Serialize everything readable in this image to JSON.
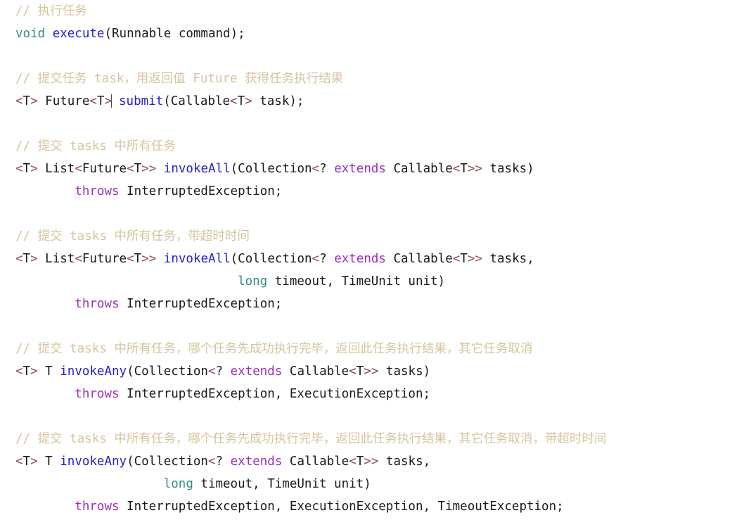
{
  "editor": {
    "background_color": "#ffffff",
    "font_size_px": 17.5,
    "line_height_px": 32,
    "caret_visible": true,
    "caret_line_index": 3,
    "colors": {
      "comment": "#d6c49c",
      "keyword": "#2f8f7f",
      "method": "#2222cc",
      "generic_bracket": "#8d4f4f",
      "throws_extends": "#9b2fbe",
      "plain_text": "#1a1a1a",
      "caret": "#4a4a55"
    }
  },
  "code": {
    "language": "java",
    "lines": [
      {
        "id": "line-1",
        "kind": "comment",
        "text": "// 执行任务",
        "tokens": [
          {
            "t": "// 执行任务",
            "c": "comment"
          }
        ]
      },
      {
        "id": "line-2",
        "kind": "signature",
        "text": "void execute(Runnable command);",
        "tokens": [
          {
            "t": "void",
            "c": "keyword"
          },
          {
            "t": " ",
            "c": "plain"
          },
          {
            "t": "execute",
            "c": "method"
          },
          {
            "t": "(Runnable command);",
            "c": "plain"
          }
        ]
      },
      {
        "id": "line-3",
        "kind": "blank",
        "text": "",
        "tokens": []
      },
      {
        "id": "line-4",
        "kind": "comment",
        "text": "// 提交任务 task，用返回值 Future 获得任务执行结果",
        "tokens": [
          {
            "t": "// 提交任务 task，用返回值 Future 获得任务执行结果",
            "c": "comment"
          }
        ]
      },
      {
        "id": "line-5",
        "kind": "signature",
        "text": "<T> Future<T> submit(Callable<T> task);",
        "tokens": [
          {
            "t": "<",
            "c": "generic"
          },
          {
            "t": "T",
            "c": "plain"
          },
          {
            "t": ">",
            "c": "generic"
          },
          {
            "t": " Future",
            "c": "plain"
          },
          {
            "t": "<",
            "c": "generic"
          },
          {
            "t": "T",
            "c": "plain"
          },
          {
            "t": ">",
            "c": "generic"
          },
          {
            "t": "CARET",
            "c": "caret"
          },
          {
            "t": " ",
            "c": "plain"
          },
          {
            "t": "submit",
            "c": "method"
          },
          {
            "t": "(Callable",
            "c": "plain"
          },
          {
            "t": "<",
            "c": "generic"
          },
          {
            "t": "T",
            "c": "plain"
          },
          {
            "t": ">",
            "c": "generic"
          },
          {
            "t": " task);",
            "c": "plain"
          }
        ]
      },
      {
        "id": "line-6",
        "kind": "blank",
        "text": "",
        "tokens": []
      },
      {
        "id": "line-7",
        "kind": "comment",
        "text": "// 提交 tasks 中所有任务",
        "tokens": [
          {
            "t": "// 提交 tasks 中所有任务",
            "c": "comment"
          }
        ]
      },
      {
        "id": "line-8",
        "kind": "signature",
        "text": "<T> List<Future<T>> invokeAll(Collection<? extends Callable<T>> tasks)",
        "tokens": [
          {
            "t": "<",
            "c": "generic"
          },
          {
            "t": "T",
            "c": "plain"
          },
          {
            "t": ">",
            "c": "generic"
          },
          {
            "t": " List",
            "c": "plain"
          },
          {
            "t": "<",
            "c": "generic"
          },
          {
            "t": "Future",
            "c": "plain"
          },
          {
            "t": "<",
            "c": "generic"
          },
          {
            "t": "T",
            "c": "plain"
          },
          {
            "t": ">>",
            "c": "generic"
          },
          {
            "t": " ",
            "c": "plain"
          },
          {
            "t": "invokeAll",
            "c": "method"
          },
          {
            "t": "(Collection",
            "c": "plain"
          },
          {
            "t": "<",
            "c": "generic"
          },
          {
            "t": "?",
            "c": "plain"
          },
          {
            "t": " ",
            "c": "plain"
          },
          {
            "t": "extends",
            "c": "throws"
          },
          {
            "t": " Callable",
            "c": "plain"
          },
          {
            "t": "<",
            "c": "generic"
          },
          {
            "t": "T",
            "c": "plain"
          },
          {
            "t": ">>",
            "c": "generic"
          },
          {
            "t": " tasks)",
            "c": "plain"
          }
        ]
      },
      {
        "id": "line-9",
        "kind": "continuation",
        "text": "        throws InterruptedException;",
        "tokens": [
          {
            "t": "        ",
            "c": "plain"
          },
          {
            "t": "throws",
            "c": "throws"
          },
          {
            "t": " InterruptedException;",
            "c": "plain"
          }
        ]
      },
      {
        "id": "line-10",
        "kind": "blank",
        "text": "",
        "tokens": []
      },
      {
        "id": "line-11",
        "kind": "comment",
        "text": "// 提交 tasks 中所有任务，带超时时间",
        "tokens": [
          {
            "t": "// 提交 tasks 中所有任务，带超时时间",
            "c": "comment"
          }
        ]
      },
      {
        "id": "line-12",
        "kind": "signature",
        "text": "<T> List<Future<T>> invokeAll(Collection<? extends Callable<T>> tasks,",
        "tokens": [
          {
            "t": "<",
            "c": "generic"
          },
          {
            "t": "T",
            "c": "plain"
          },
          {
            "t": ">",
            "c": "generic"
          },
          {
            "t": " List",
            "c": "plain"
          },
          {
            "t": "<",
            "c": "generic"
          },
          {
            "t": "Future",
            "c": "plain"
          },
          {
            "t": "<",
            "c": "generic"
          },
          {
            "t": "T",
            "c": "plain"
          },
          {
            "t": ">>",
            "c": "generic"
          },
          {
            "t": " ",
            "c": "plain"
          },
          {
            "t": "invokeAll",
            "c": "method"
          },
          {
            "t": "(Collection",
            "c": "plain"
          },
          {
            "t": "<",
            "c": "generic"
          },
          {
            "t": "?",
            "c": "plain"
          },
          {
            "t": " ",
            "c": "plain"
          },
          {
            "t": "extends",
            "c": "throws"
          },
          {
            "t": " Callable",
            "c": "plain"
          },
          {
            "t": "<",
            "c": "generic"
          },
          {
            "t": "T",
            "c": "plain"
          },
          {
            "t": ">>",
            "c": "generic"
          },
          {
            "t": " tasks,",
            "c": "plain"
          }
        ]
      },
      {
        "id": "line-13",
        "kind": "continuation",
        "text": "                              long timeout, TimeUnit unit)",
        "tokens": [
          {
            "t": "                              ",
            "c": "plain"
          },
          {
            "t": "long",
            "c": "keyword"
          },
          {
            "t": " timeout, TimeUnit unit)",
            "c": "plain"
          }
        ]
      },
      {
        "id": "line-14",
        "kind": "continuation",
        "text": "        throws InterruptedException;",
        "tokens": [
          {
            "t": "        ",
            "c": "plain"
          },
          {
            "t": "throws",
            "c": "throws"
          },
          {
            "t": " InterruptedException;",
            "c": "plain"
          }
        ]
      },
      {
        "id": "line-15",
        "kind": "blank",
        "text": "",
        "tokens": []
      },
      {
        "id": "line-16",
        "kind": "comment",
        "text": "// 提交 tasks 中所有任务，哪个任务先成功执行完毕，返回此任务执行结果，其它任务取消",
        "tokens": [
          {
            "t": "// 提交 tasks 中所有任务，哪个任务先成功执行完毕，返回此任务执行结果，其它任务取消",
            "c": "comment"
          }
        ]
      },
      {
        "id": "line-17",
        "kind": "signature",
        "text": "<T> T invokeAny(Collection<? extends Callable<T>> tasks)",
        "tokens": [
          {
            "t": "<",
            "c": "generic"
          },
          {
            "t": "T",
            "c": "plain"
          },
          {
            "t": ">",
            "c": "generic"
          },
          {
            "t": " T ",
            "c": "plain"
          },
          {
            "t": "invokeAny",
            "c": "method"
          },
          {
            "t": "(Collection",
            "c": "plain"
          },
          {
            "t": "<",
            "c": "generic"
          },
          {
            "t": "?",
            "c": "plain"
          },
          {
            "t": " ",
            "c": "plain"
          },
          {
            "t": "extends",
            "c": "throws"
          },
          {
            "t": " Callable",
            "c": "plain"
          },
          {
            "t": "<",
            "c": "generic"
          },
          {
            "t": "T",
            "c": "plain"
          },
          {
            "t": ">>",
            "c": "generic"
          },
          {
            "t": " tasks)",
            "c": "plain"
          }
        ]
      },
      {
        "id": "line-18",
        "kind": "continuation",
        "text": "        throws InterruptedException, ExecutionException;",
        "tokens": [
          {
            "t": "        ",
            "c": "plain"
          },
          {
            "t": "throws",
            "c": "throws"
          },
          {
            "t": " InterruptedException, ExecutionException;",
            "c": "plain"
          }
        ]
      },
      {
        "id": "line-19",
        "kind": "blank",
        "text": "",
        "tokens": []
      },
      {
        "id": "line-20",
        "kind": "comment",
        "text": "// 提交 tasks 中所有任务，哪个任务先成功执行完毕，返回此任务执行结果，其它任务取消，带超时时间",
        "tokens": [
          {
            "t": "// 提交 tasks 中所有任务，哪个任务先成功执行完毕，返回此任务执行结果，其它任务取消，带超时时间",
            "c": "comment"
          }
        ]
      },
      {
        "id": "line-21",
        "kind": "signature",
        "text": "<T> T invokeAny(Collection<? extends Callable<T>> tasks,",
        "tokens": [
          {
            "t": "<",
            "c": "generic"
          },
          {
            "t": "T",
            "c": "plain"
          },
          {
            "t": ">",
            "c": "generic"
          },
          {
            "t": " T ",
            "c": "plain"
          },
          {
            "t": "invokeAny",
            "c": "method"
          },
          {
            "t": "(Collection",
            "c": "plain"
          },
          {
            "t": "<",
            "c": "generic"
          },
          {
            "t": "?",
            "c": "plain"
          },
          {
            "t": " ",
            "c": "plain"
          },
          {
            "t": "extends",
            "c": "throws"
          },
          {
            "t": " Callable",
            "c": "plain"
          },
          {
            "t": "<",
            "c": "generic"
          },
          {
            "t": "T",
            "c": "plain"
          },
          {
            "t": ">>",
            "c": "generic"
          },
          {
            "t": " tasks,",
            "c": "plain"
          }
        ]
      },
      {
        "id": "line-22",
        "kind": "continuation",
        "text": "                    long timeout, TimeUnit unit)",
        "tokens": [
          {
            "t": "                    ",
            "c": "plain"
          },
          {
            "t": "long",
            "c": "keyword"
          },
          {
            "t": " timeout, TimeUnit unit)",
            "c": "plain"
          }
        ]
      },
      {
        "id": "line-23",
        "kind": "continuation",
        "text": "        throws InterruptedException, ExecutionException, TimeoutException;",
        "tokens": [
          {
            "t": "        ",
            "c": "plain"
          },
          {
            "t": "throws",
            "c": "throws"
          },
          {
            "t": " InterruptedException, ExecutionException, TimeoutException;",
            "c": "plain"
          }
        ]
      }
    ]
  }
}
